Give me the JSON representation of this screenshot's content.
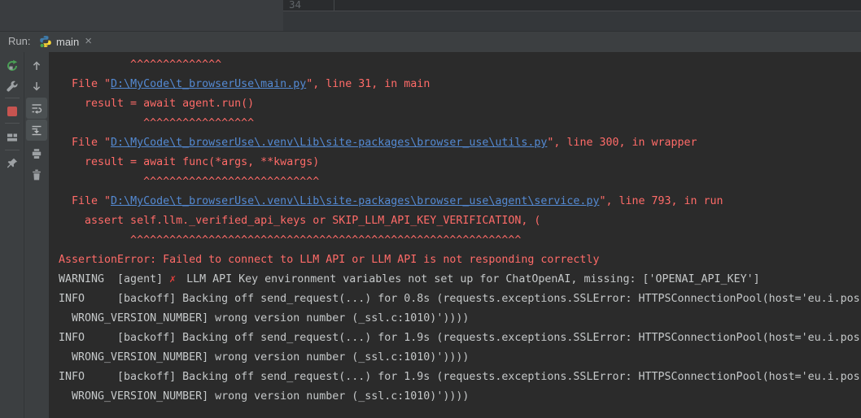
{
  "editor": {
    "line_number": "34"
  },
  "run_bar": {
    "label": "Run:",
    "tab_title": "main",
    "close_glyph": "×",
    "tab_icon": "python-icon"
  },
  "toolbar": {
    "left_icons": [
      "rerun-icon",
      "settings-wrench-icon",
      "stop-icon",
      "restore-layout-icon",
      "pin-icon"
    ],
    "right_icons": [
      "arrow-up-icon",
      "arrow-down-icon",
      "soft-wrap-icon",
      "scroll-to-end-icon",
      "print-icon",
      "trash-icon"
    ],
    "toggled_on": [
      "soft-wrap-icon",
      "scroll-to-end-icon"
    ]
  },
  "colors": {
    "error_red": "#ff6b68",
    "link_blue": "#548ad3",
    "stdout_gray": "#c5c8c9",
    "stop_red": "#c75450",
    "run_green": "#499C54",
    "panel_bg": "#3c3f41",
    "console_bg": "#2b2b2b"
  },
  "console": {
    "lines": [
      {
        "segments": [
          {
            "t": "           ^^^^^^^^^^^^^^",
            "c": "err"
          }
        ]
      },
      {
        "segments": [
          {
            "t": "  File \"",
            "c": "err"
          },
          {
            "t": "D:\\MyCode\\t_browserUse\\main.py",
            "c": "link"
          },
          {
            "t": "\", line 31, in main",
            "c": "err"
          }
        ]
      },
      {
        "segments": [
          {
            "t": "    result = await agent.run()",
            "c": "err"
          }
        ]
      },
      {
        "segments": [
          {
            "t": "             ^^^^^^^^^^^^^^^^^",
            "c": "err"
          }
        ]
      },
      {
        "segments": [
          {
            "t": "  File \"",
            "c": "err"
          },
          {
            "t": "D:\\MyCode\\t_browserUse\\.venv\\Lib\\site-packages\\browser_use\\utils.py",
            "c": "link"
          },
          {
            "t": "\", line 300, in wrapper",
            "c": "err"
          }
        ]
      },
      {
        "segments": [
          {
            "t": "    result = await func(*args, **kwargs)",
            "c": "err"
          }
        ]
      },
      {
        "segments": [
          {
            "t": "             ^^^^^^^^^^^^^^^^^^^^^^^^^^^",
            "c": "err"
          }
        ]
      },
      {
        "segments": [
          {
            "t": "  File \"",
            "c": "err"
          },
          {
            "t": "D:\\MyCode\\t_browserUse\\.venv\\Lib\\site-packages\\browser_use\\agent\\service.py",
            "c": "link"
          },
          {
            "t": "\", line 793, in run",
            "c": "err"
          }
        ]
      },
      {
        "segments": [
          {
            "t": "    assert self.llm._verified_api_keys or SKIP_LLM_API_KEY_VERIFICATION, (",
            "c": "err"
          }
        ]
      },
      {
        "segments": [
          {
            "t": "           ^^^^^^^^^^^^^^^^^^^^^^^^^^^^^^^^^^^^^^^^^^^^^^^^^^^^^^^^^^^^",
            "c": "err"
          }
        ]
      },
      {
        "segments": [
          {
            "t": "AssertionError: Failed to connect to LLM API or LLM API is not responding correctly",
            "c": "err"
          }
        ]
      },
      {
        "segments": [
          {
            "t": "WARNING  [agent] ",
            "c": "out"
          },
          {
            "t": "✗",
            "c": "xmark"
          },
          {
            "t": " LLM API Key environment variables not set up for ChatOpenAI, missing: ['OPENAI_API_KEY']",
            "c": "out"
          }
        ]
      },
      {
        "segments": [
          {
            "t": "INFO     [backoff] Backing off send_request(...) for 0.8s (requests.exceptions.SSLError: HTTPSConnectionPool(host='eu.i.pos",
            "c": "out"
          }
        ]
      },
      {
        "segments": [
          {
            "t": "  WRONG_VERSION_NUMBER] wrong version number (_ssl.c:1010)'))))",
            "c": "out"
          }
        ]
      },
      {
        "segments": [
          {
            "t": "INFO     [backoff] Backing off send_request(...) for 1.9s (requests.exceptions.SSLError: HTTPSConnectionPool(host='eu.i.pos",
            "c": "out"
          }
        ]
      },
      {
        "segments": [
          {
            "t": "  WRONG_VERSION_NUMBER] wrong version number (_ssl.c:1010)'))))",
            "c": "out"
          }
        ]
      },
      {
        "segments": [
          {
            "t": "INFO     [backoff] Backing off send_request(...) for 1.9s (requests.exceptions.SSLError: HTTPSConnectionPool(host='eu.i.pos",
            "c": "out"
          }
        ]
      },
      {
        "segments": [
          {
            "t": "  WRONG_VERSION_NUMBER] wrong version number (_ssl.c:1010)'))))",
            "c": "out"
          }
        ]
      }
    ]
  }
}
